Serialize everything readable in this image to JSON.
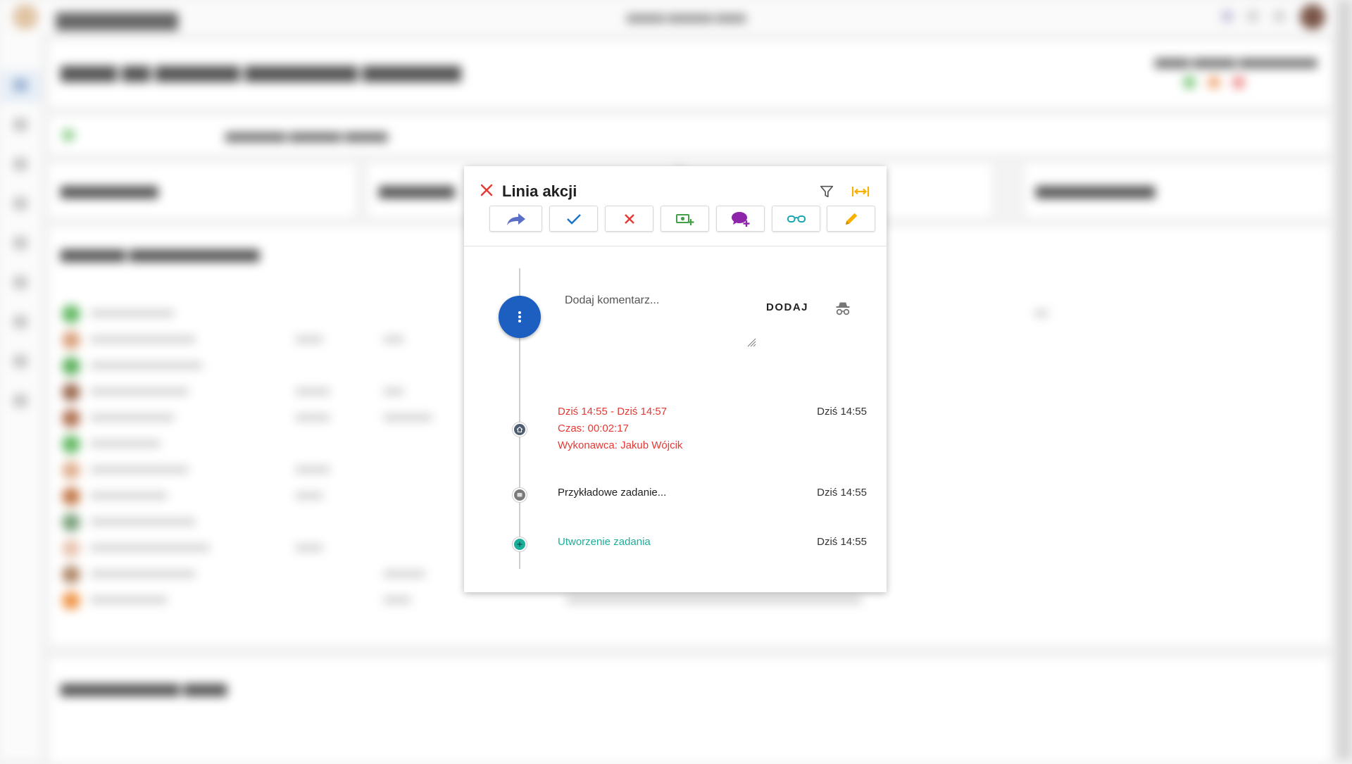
{
  "modal": {
    "title": "Linia akcji",
    "comment_placeholder": "Dodaj komentarz...",
    "add_label": "DODAJ",
    "toolbar": [
      {
        "name": "forward",
        "color": "#5b6fc7"
      },
      {
        "name": "check",
        "color": "#1a73c7"
      },
      {
        "name": "reject",
        "color": "#e53935"
      },
      {
        "name": "add-cost",
        "color": "#43a047"
      },
      {
        "name": "add-comment",
        "color": "#8e24aa"
      },
      {
        "name": "watch",
        "color": "#1aa6b0"
      },
      {
        "name": "edit",
        "color": "#f9b000"
      }
    ],
    "events": [
      {
        "lines": [
          "Dziś 14:55 - Dziś 14:57",
          "Czas: 00:02:17",
          "Wykonawca: Jakub Wójcik"
        ],
        "time": "Dziś 14:55",
        "color": "#e53935",
        "icon": "home-icon"
      },
      {
        "lines": [
          "Przykładowe zadanie..."
        ],
        "time": "Dziś 14:55",
        "color": "#222222",
        "icon": "comment-icon"
      },
      {
        "lines": [
          "Utworzenie zadania"
        ],
        "time": "Dziś 14:55",
        "color": "#1bae9a",
        "icon": "plus-icon"
      }
    ]
  },
  "colors": {
    "close": "#e53935",
    "expand": "#f9b000",
    "fab": "#1c5fc1"
  }
}
